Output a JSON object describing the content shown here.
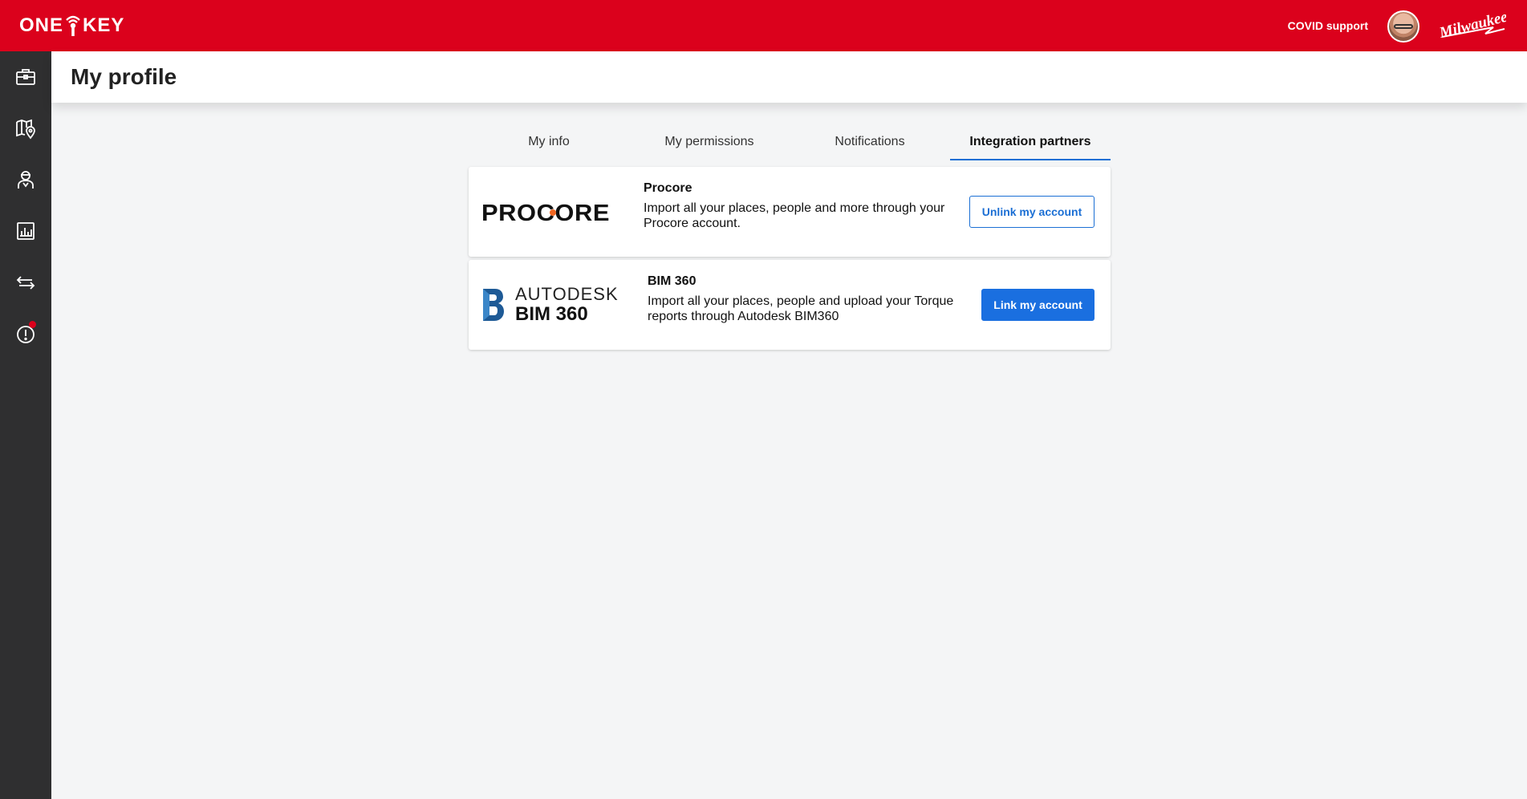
{
  "topbar": {
    "brand": "ONE KEY",
    "covid_link": "COVID support",
    "milwaukee_logo": "Milwaukee",
    "colors": {
      "brand_red": "#db011c"
    }
  },
  "sidebar": {
    "items": [
      {
        "icon": "toolbox-icon"
      },
      {
        "icon": "map-pin-icon"
      },
      {
        "icon": "person-icon"
      },
      {
        "icon": "report-chart-icon"
      },
      {
        "icon": "transfer-arrows-icon"
      },
      {
        "icon": "alert-icon",
        "has_notification": true
      }
    ]
  },
  "page": {
    "title": "My profile"
  },
  "tabs": [
    {
      "label": "My info",
      "active": false
    },
    {
      "label": "My permissions",
      "active": false
    },
    {
      "label": "Notifications",
      "active": false
    },
    {
      "label": "Integration partners",
      "active": true
    }
  ],
  "integrations": [
    {
      "name": "Procore",
      "logo_text": "PROCORE",
      "description": "Import all your places, people and more through your Procore account.",
      "button_label": "Unlink my account",
      "linked": true
    },
    {
      "name": "BIM 360",
      "logo_line1": "AUTODESK",
      "logo_line2": "BIM 360",
      "description": "Import all your places, people and upload your Torque reports through Autodesk BIM360",
      "button_label": "Link my account",
      "linked": false
    }
  ],
  "colors": {
    "accent_blue": "#1a6fe0",
    "sidebar_bg": "#2f2f30"
  }
}
